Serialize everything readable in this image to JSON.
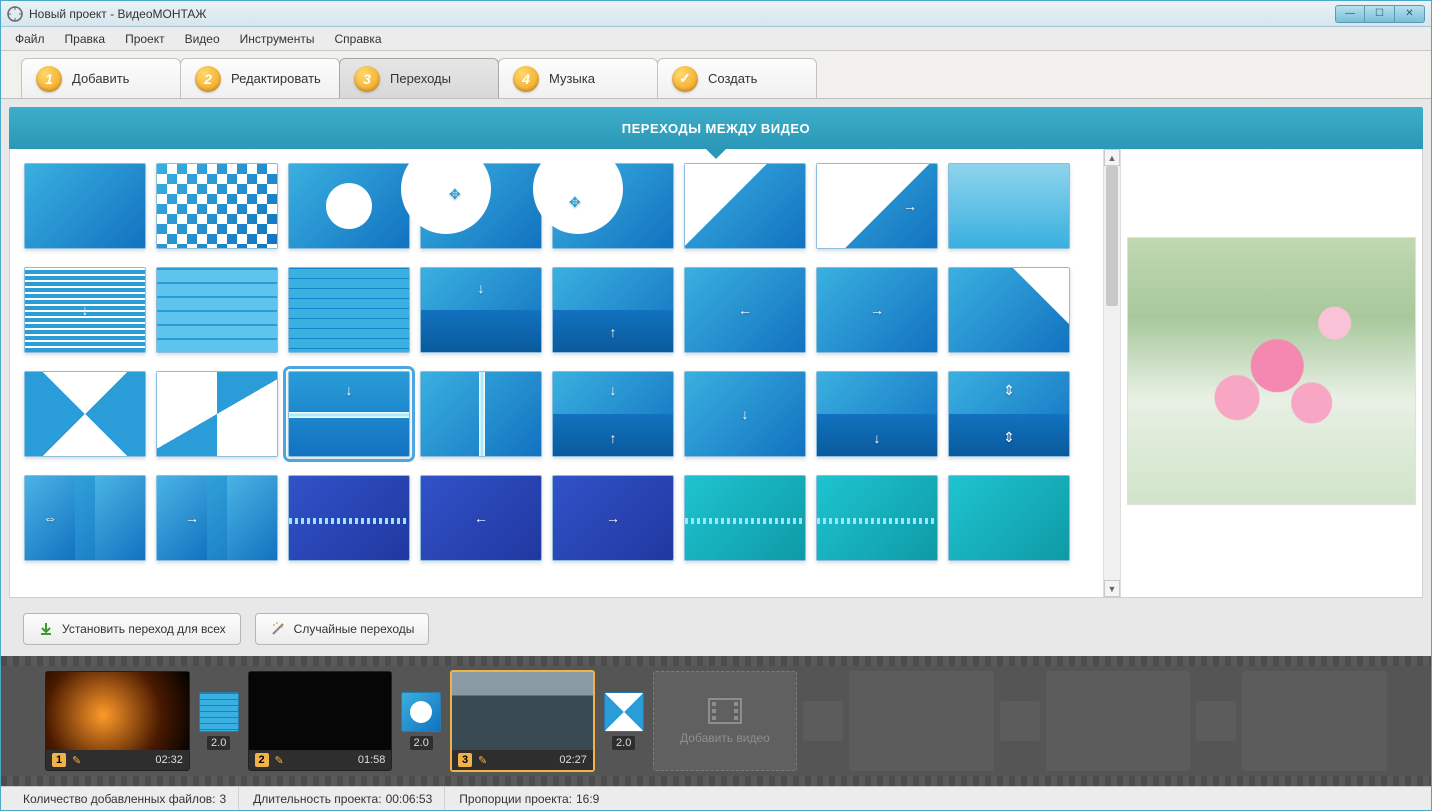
{
  "window": {
    "title": "Новый проект - ВидеоМОНТАЖ"
  },
  "menu": {
    "items": [
      "Файл",
      "Правка",
      "Проект",
      "Видео",
      "Инструменты",
      "Справка"
    ]
  },
  "tabs": {
    "items": [
      {
        "num": "1",
        "label": "Добавить"
      },
      {
        "num": "2",
        "label": "Редактировать"
      },
      {
        "num": "3",
        "label": "Переходы"
      },
      {
        "num": "4",
        "label": "Музыка"
      },
      {
        "num": "✓",
        "label": "Создать"
      }
    ],
    "active_index": 2
  },
  "section": {
    "title": "ПЕРЕХОДЫ МЕЖДУ ВИДЕО"
  },
  "gallery": {
    "selected_index": 18
  },
  "actions": {
    "apply_all": "Установить переход для всех",
    "random": "Случайные переходы"
  },
  "timeline": {
    "clips": [
      {
        "index": "1",
        "duration": "02:32"
      },
      {
        "index": "2",
        "duration": "01:58"
      },
      {
        "index": "3",
        "duration": "02:27"
      }
    ],
    "transitions": [
      {
        "duration": "2.0"
      },
      {
        "duration": "2.0"
      },
      {
        "duration": "2.0"
      }
    ],
    "add_label": "Добавить видео",
    "selected_clip": 2
  },
  "status": {
    "files_label": "Количество добавленных файлов:",
    "files_value": "3",
    "length_label": "Длительность проекта:",
    "length_value": "00:06:53",
    "aspect_label": "Пропорции проекта:",
    "aspect_value": "16:9"
  }
}
